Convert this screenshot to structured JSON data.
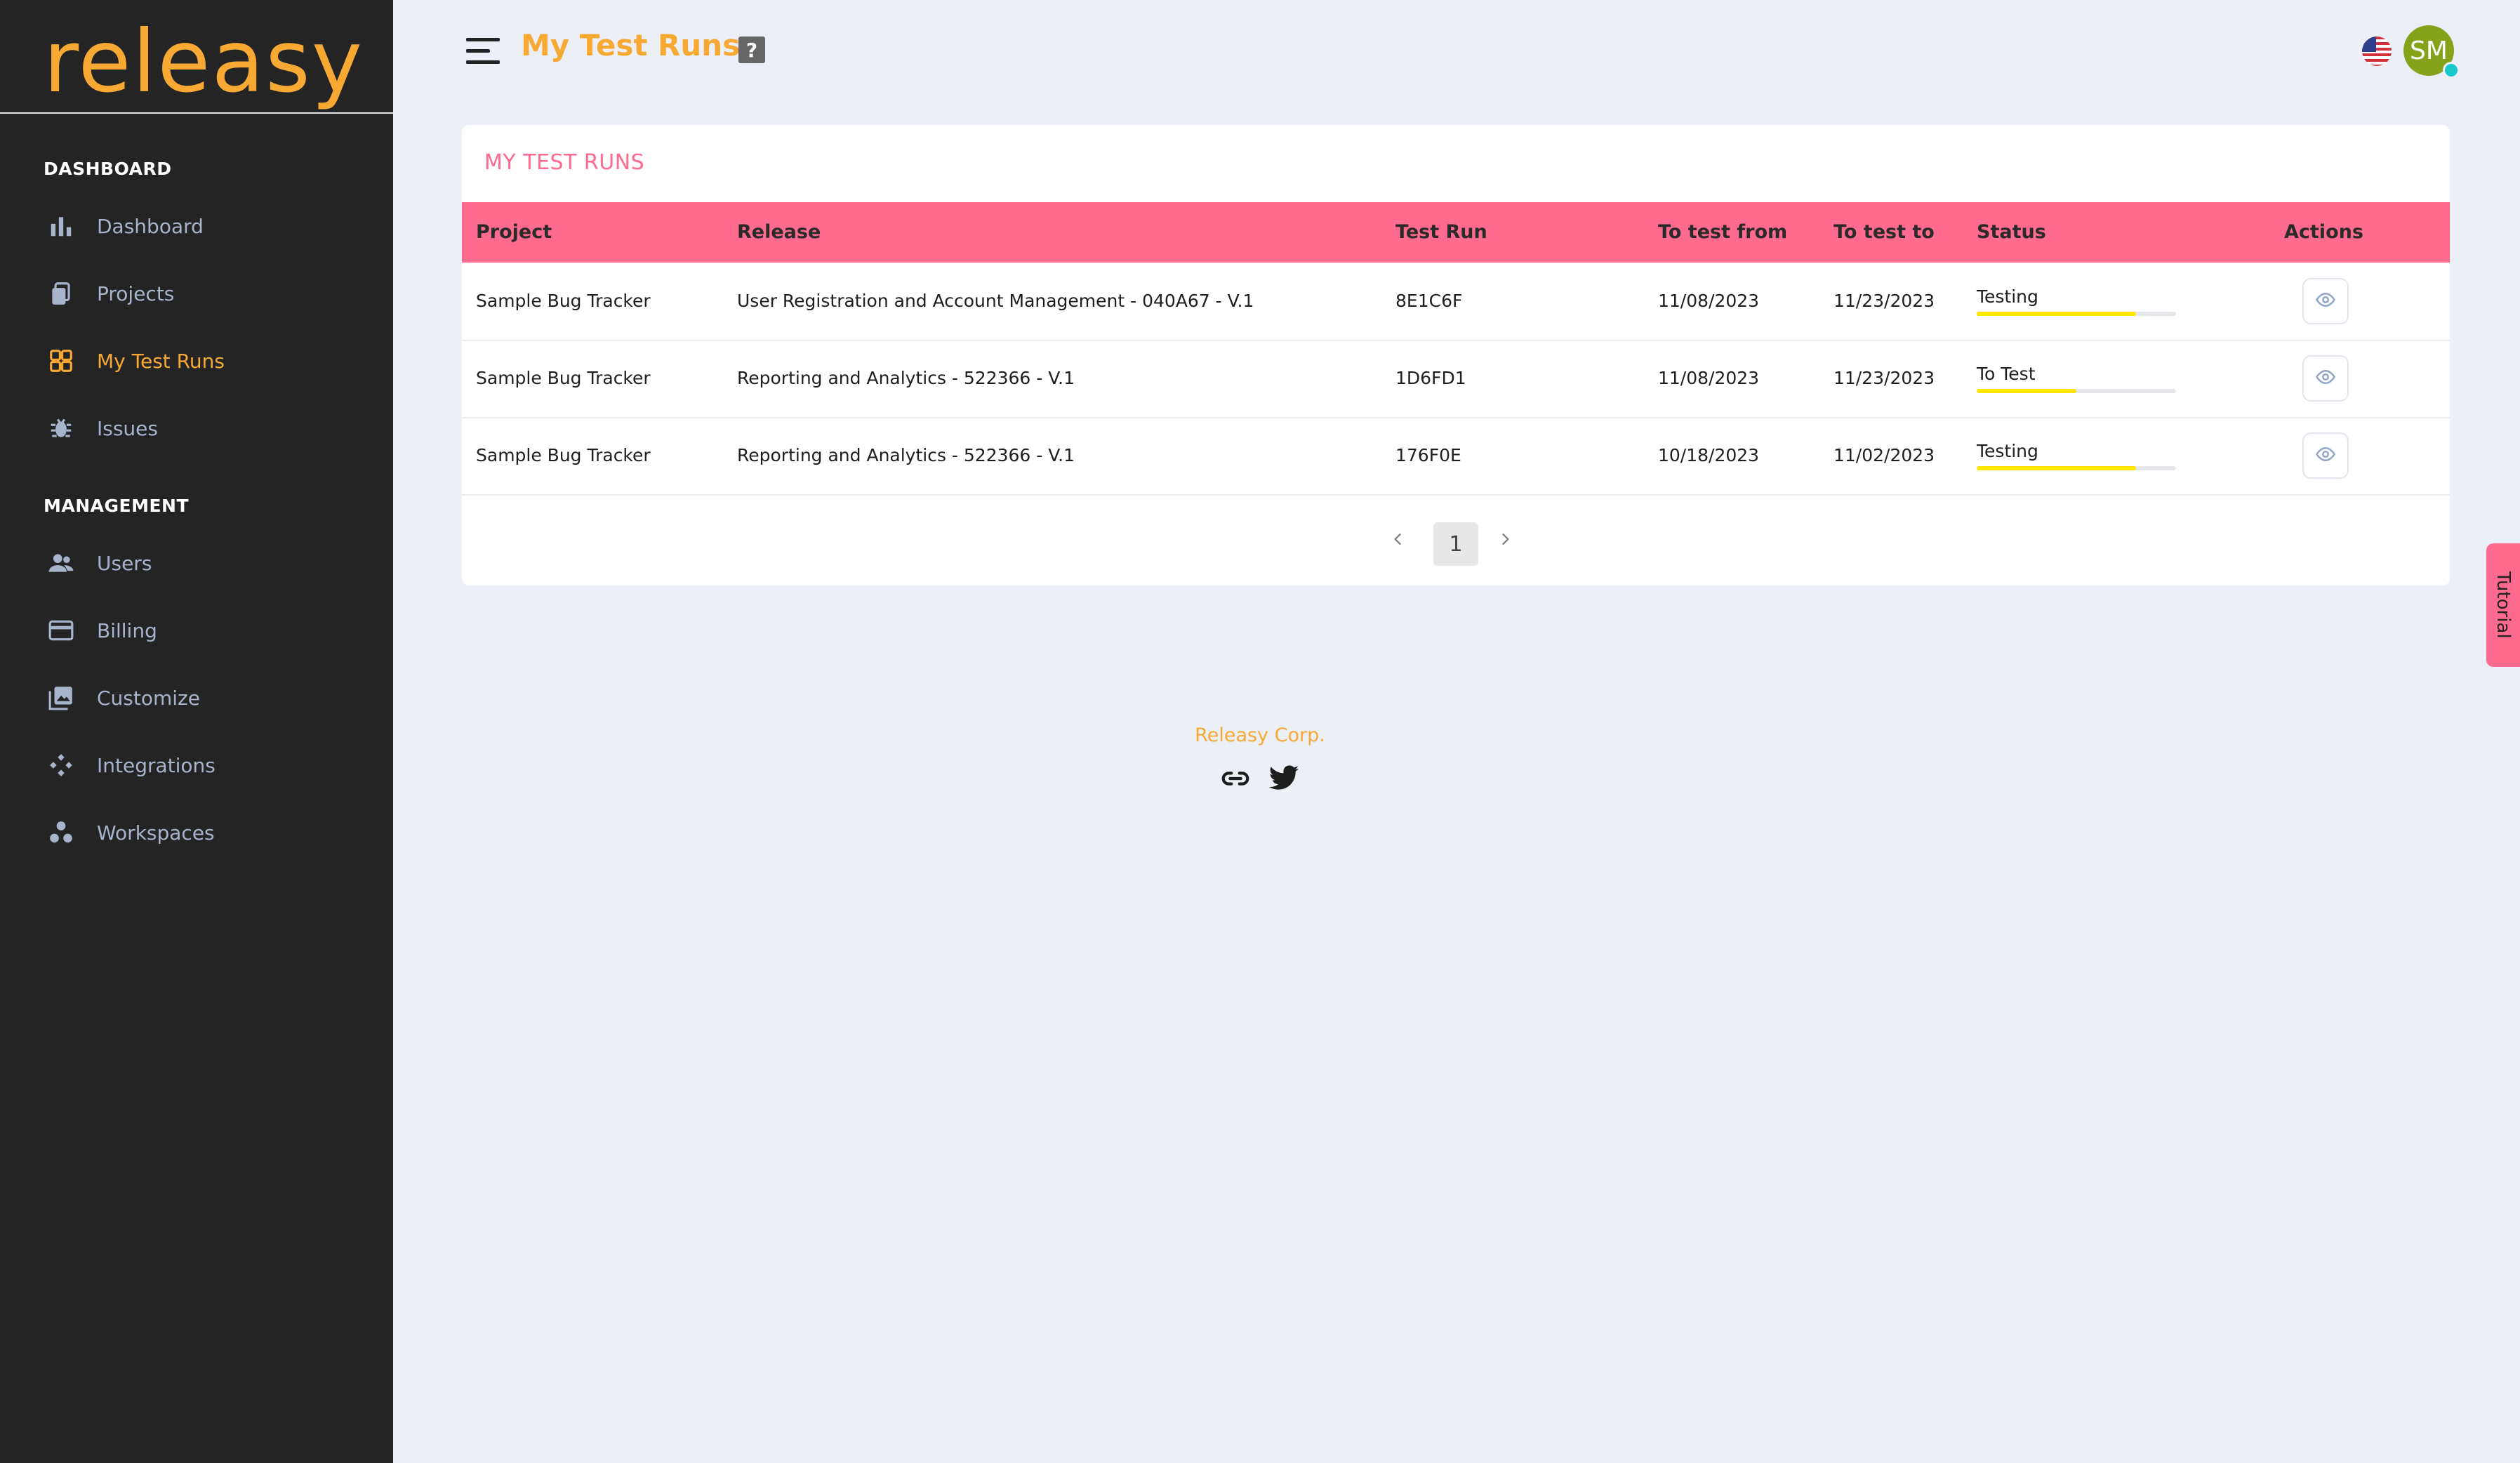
{
  "app": {
    "logo_text": "releasy",
    "brand_color": "#f7a934",
    "accent_color": "#ff6b8e"
  },
  "sidebar": {
    "sections": [
      {
        "title": "DASHBOARD"
      },
      {
        "title": "MANAGEMENT"
      }
    ],
    "items": [
      {
        "label": "Dashboard",
        "icon": "bar-chart-icon"
      },
      {
        "label": "Projects",
        "icon": "copy-icon"
      },
      {
        "label": "My Test Runs",
        "icon": "grid-icon",
        "active": true
      },
      {
        "label": "Issues",
        "icon": "bug-icon"
      },
      {
        "label": "Users",
        "icon": "users-icon"
      },
      {
        "label": "Billing",
        "icon": "card-icon"
      },
      {
        "label": "Customize",
        "icon": "image-icon"
      },
      {
        "label": "Integrations",
        "icon": "integrations-icon"
      },
      {
        "label": "Workspaces",
        "icon": "workspaces-icon"
      }
    ]
  },
  "header": {
    "title": "My Test Runs",
    "help": "?",
    "language": "us-flag-icon",
    "avatar_initials": "SM"
  },
  "card": {
    "title": "MY TEST RUNS",
    "columns": [
      "Project",
      "Release",
      "Test Run",
      "To test from",
      "To test to",
      "Status",
      "Actions"
    ],
    "rows": [
      {
        "project": "Sample Bug Tracker",
        "release": "User Registration and Account Management - 040A67 - V.1",
        "test_run": "8E1C6F",
        "from": "11/08/2023",
        "to": "11/23/2023",
        "status": "Testing",
        "progress": 0.8
      },
      {
        "project": "Sample Bug Tracker",
        "release": "Reporting and Analytics - 522366 - V.1",
        "test_run": "1D6FD1",
        "from": "11/08/2023",
        "to": "11/23/2023",
        "status": "To Test",
        "progress": 0.5
      },
      {
        "project": "Sample Bug Tracker",
        "release": "Reporting and Analytics - 522366 - V.1",
        "test_run": "176F0E",
        "from": "10/18/2023",
        "to": "11/02/2023",
        "status": "Testing",
        "progress": 0.8
      }
    ],
    "pagination": {
      "current": "1"
    }
  },
  "footer": {
    "company": "Releasy Corp."
  },
  "tutorial": {
    "label": "Tutorial"
  }
}
